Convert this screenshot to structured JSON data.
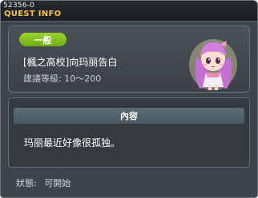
{
  "window": {
    "quest_id": "52356-0",
    "title": "QUEST INFO"
  },
  "quest": {
    "category": "一般",
    "name": "[楓之高校]向玛丽告白",
    "level_requirement": "建議等級: 10～200"
  },
  "npc": {
    "portrait_icon": "npc-girl-pink-hair"
  },
  "content": {
    "header": "內容",
    "text": "玛丽最近好像很孤独。"
  },
  "status": {
    "label": "狀態:",
    "value": "可開始"
  },
  "colors": {
    "title_accent": "#f4c73a",
    "badge_green": "#8cc820",
    "header_teal": "#55666e"
  }
}
